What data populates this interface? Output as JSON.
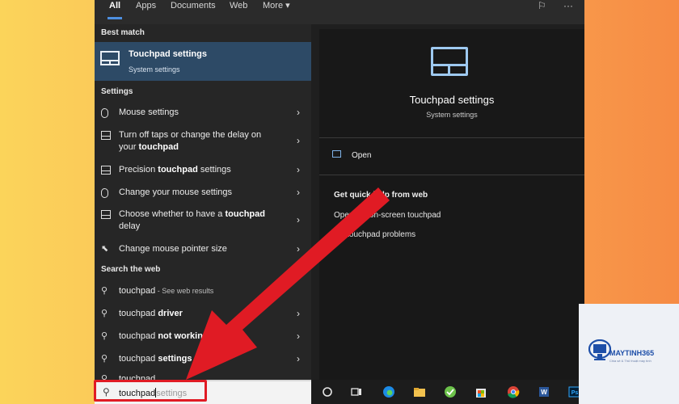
{
  "tabs": [
    "All",
    "Apps",
    "Documents",
    "Web",
    "More"
  ],
  "best_match": {
    "heading": "Best match",
    "title": "Touchpad settings",
    "subtitle": "System settings"
  },
  "settings": {
    "heading": "Settings",
    "items": [
      {
        "text": "Mouse settings"
      },
      {
        "pre": "Turn off taps or change the delay on your ",
        "bold": "touchpad",
        "post": ""
      },
      {
        "pre": "Precision ",
        "bold": "touchpad",
        "post": " settings"
      },
      {
        "text": "Change your mouse settings"
      },
      {
        "pre": "Choose whether to have a ",
        "bold": "touchpad",
        "post": " delay"
      },
      {
        "text": "Change mouse pointer size"
      }
    ]
  },
  "web": {
    "heading": "Search the web",
    "items": [
      {
        "pre": "touchpad",
        "bold": "",
        "post": "",
        "muted": " - See web results"
      },
      {
        "pre": "touchpad ",
        "bold": "driver",
        "post": ""
      },
      {
        "pre": "touchpad ",
        "bold": "not working",
        "post": ""
      },
      {
        "pre": "touchpad ",
        "bold": "settings",
        "post": ""
      },
      {
        "pre": "touchpad ",
        "bold": "",
        "post": ""
      }
    ]
  },
  "preview": {
    "title": "Touchpad settings",
    "subtitle": "System settings",
    "open_label": "Open",
    "help_heading": "Get quick help from web",
    "help_links": [
      "Open the on-screen touchpad",
      "Fix touchpad problems"
    ]
  },
  "search": {
    "query": "touchpad",
    "suggestion": "settings"
  },
  "watermark": {
    "name": "MAYTINH365",
    "tagline": "Chia sẻ & Thủ thuật máy tính"
  },
  "colors": {
    "accent": "#4d8fe0",
    "best_match_bg": "#2d4a66",
    "highlight": "#e01b24"
  }
}
